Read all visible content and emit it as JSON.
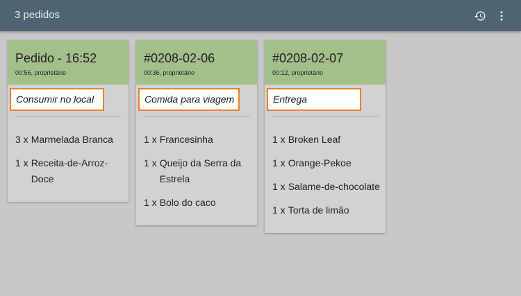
{
  "appbar": {
    "title": "3 pedidos",
    "icons": [
      "history-icon",
      "more-vert-icon"
    ]
  },
  "colors": {
    "appbar": "#4e6472",
    "card_header": "#a3c08b",
    "order_type_border": "#ee7f2d",
    "background": "#c8c8c8"
  },
  "orders": [
    {
      "title": "Pedido - 16:52",
      "subtitle": "00:56, proprietário",
      "order_type": "Consumir no local",
      "items": [
        {
          "qty": "3 x",
          "name": "Marmelada Branca"
        },
        {
          "qty": "1 x",
          "name": "Receita-de-Arroz-Doce"
        }
      ]
    },
    {
      "title": "#0208-02-06",
      "subtitle": "00:36, proprietário",
      "order_type": "Comida para viagem",
      "items": [
        {
          "qty": "1 x",
          "name": "Francesinha"
        },
        {
          "qty": "1 x",
          "name": "Queijo da Serra da Estrela"
        },
        {
          "qty": "1 x",
          "name": "Bolo do caco"
        }
      ]
    },
    {
      "title": "#0208-02-07",
      "subtitle": "00:12, proprietário",
      "order_type": "Entrega",
      "items": [
        {
          "qty": "1 x",
          "name": "Broken Leaf"
        },
        {
          "qty": "1 x",
          "name": "Orange-Pekoe"
        },
        {
          "qty": "1 x",
          "name": "Salame-de-chocolate"
        },
        {
          "qty": "1 x",
          "name": "Torta de limão"
        }
      ]
    }
  ]
}
